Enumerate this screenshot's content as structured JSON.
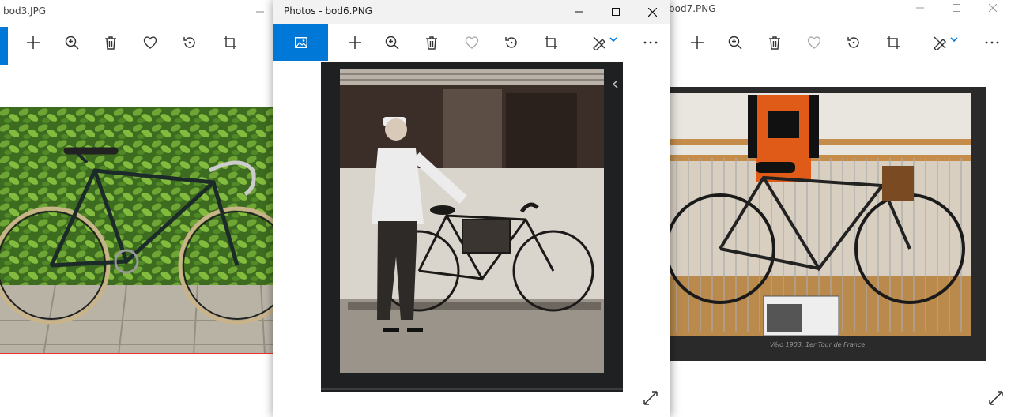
{
  "windows": {
    "left": {
      "title": "bod3.JPG"
    },
    "center": {
      "title": "Photos - bod6.PNG"
    },
    "right": {
      "title": "bod7.PNG",
      "caption": "Vélo 1903, 1er Tour de France"
    }
  },
  "colors": {
    "accent": "#0078d7",
    "titlebar_inactive": "#ffffff",
    "titlebar_active": "#f2f2f2"
  },
  "icons": [
    "photo-icon",
    "plus-icon",
    "zoom-in-icon",
    "trash-icon",
    "heart-icon",
    "rotate-icon",
    "crop-icon",
    "edit-draw-icon",
    "chevron-down-icon",
    "more-icon",
    "expand-icon",
    "minimize-icon",
    "maximize-icon",
    "close-icon"
  ]
}
